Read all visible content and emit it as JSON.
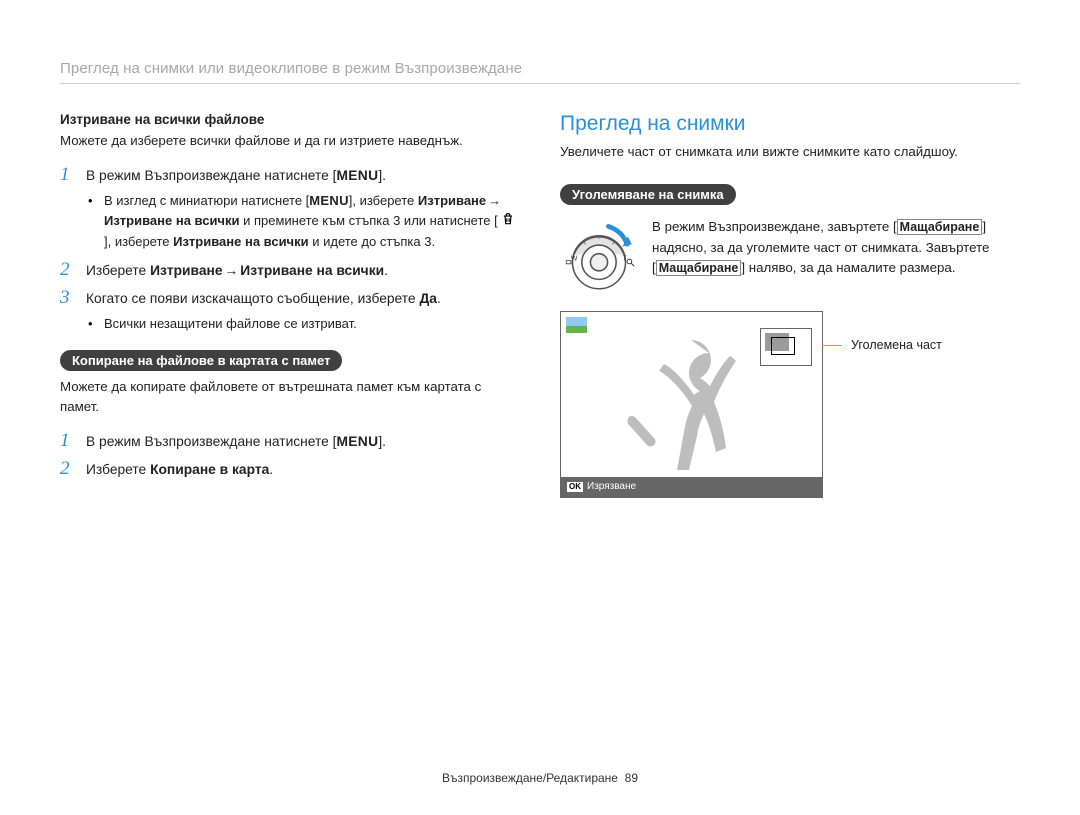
{
  "header": "Преглед на снимки или видеоклипове в режим Възпроизвеждане",
  "left": {
    "subhead": "Изтриване на всички файлове",
    "intro": "Можете да изберете всички файлове и да ги изтриете наведнъж.",
    "step1_pre": "В режим Възпроизвеждане натиснете [",
    "step1_menu": "MENU",
    "step1_post": "].",
    "bullet1_a": "В изглед с миниатюри натиснете [",
    "bullet1_b": "], изберете ",
    "bullet1_c_bold": "Изтриване",
    "bullet1_d_bold": "Изтриване на всички",
    "bullet1_e": " и преминете към стъпка 3 или натиснете [",
    "bullet1_f": "], изберете ",
    "bullet1_g_bold": "Изтриване на всички",
    "bullet1_h": " и идете до стъпка 3.",
    "step2_pre": "Изберете ",
    "step2_a_bold": "Изтриване",
    "step2_b_bold": "Изтриване на всички",
    "step2_post": ".",
    "step3_pre": "Когато се появи изскачащото съобщение, изберете ",
    "step3_bold": "Да",
    "step3_post": ".",
    "bullet3": "Всички незащитени файлове се изтриват.",
    "pill2": "Копиране на файлове в картата с памет",
    "intro2": "Можете да копирате файловете от вътрешната памет към картата с памет.",
    "step1b_pre": "В режим Възпроизвеждане натиснете [",
    "step1b_menu": "MENU",
    "step1b_post": "].",
    "step2b_pre": "Изберете ",
    "step2b_bold": "Копиране в карта",
    "step2b_post": "."
  },
  "right": {
    "title": "Преглед на снимки",
    "intro": "Увеличете част от снимката или вижте снимките като слайдшоу.",
    "pill": "Уголемяване на снимка",
    "zoom_a": "В режим Възпроизвеждане, завъртете [",
    "zoom_b": "Мащабиране",
    "zoom_c": "] надясно, за да уголемите част от снимката. Завъртете [",
    "zoom_d": "Мащабиране",
    "zoom_e": "] наляво, за да намалите размера.",
    "callout": "Уголемена част",
    "ok": "OK",
    "crop": "Изрязване",
    "labels": {
      "w": "W",
      "t": "T"
    }
  },
  "footer": {
    "text": "Възпроизвеждане/Редактиране",
    "page": "89"
  }
}
